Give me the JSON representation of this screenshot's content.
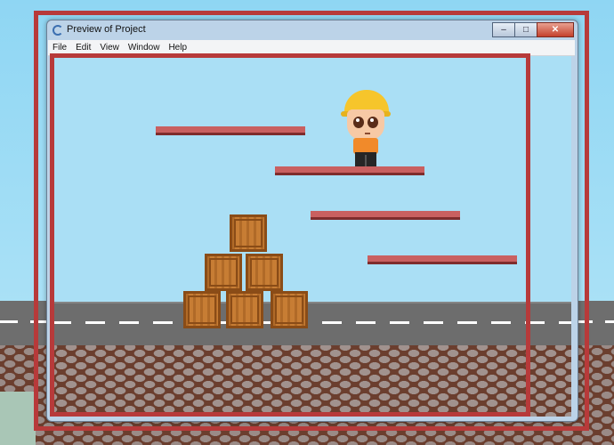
{
  "window": {
    "title": "Preview of Project",
    "controls": {
      "minimize": "–",
      "maximize": "□",
      "close": "✕"
    }
  },
  "menu": [
    "File",
    "Edit",
    "View",
    "Window",
    "Help"
  ],
  "scene": {
    "platforms": 4,
    "crates": 6,
    "character": "construction-worker",
    "colors": {
      "sky": "#aadff5",
      "platform": "#c96060",
      "crate": "#c77d34",
      "ground": "#6b3e2e",
      "road": "#6d6d6d",
      "selection": "#b73a3a"
    }
  }
}
